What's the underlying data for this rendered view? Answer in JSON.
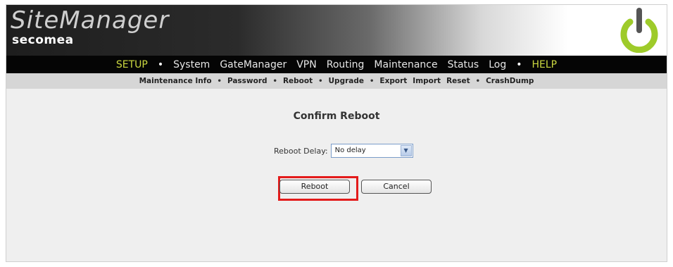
{
  "brand": {
    "title": "SiteManager",
    "subtitle": "secomea"
  },
  "nav": {
    "setup": "SETUP",
    "system": "System",
    "gatemanager": "GateManager",
    "vpn": "VPN",
    "routing": "Routing",
    "maintenance": "Maintenance",
    "status": "Status",
    "log": "Log",
    "help": "HELP",
    "separator": "•"
  },
  "subnav": {
    "maintenance_info": "Maintenance Info",
    "password": "Password",
    "reboot": "Reboot",
    "upgrade": "Upgrade",
    "export": "Export",
    "import": "Import",
    "reset": "Reset",
    "crashdump": "CrashDump",
    "separator": "•"
  },
  "page": {
    "title": "Confirm Reboot",
    "delay_label": "Reboot Delay:",
    "delay_value": "No delay",
    "reboot_button": "Reboot",
    "cancel_button": "Cancel"
  },
  "icons": {
    "power": "power-icon",
    "dropdown": "chevron-down-icon"
  },
  "colors": {
    "nav_highlight": "#cbd840",
    "highlight_box": "#e31b1b",
    "power_icon": "#9ecb2a"
  }
}
